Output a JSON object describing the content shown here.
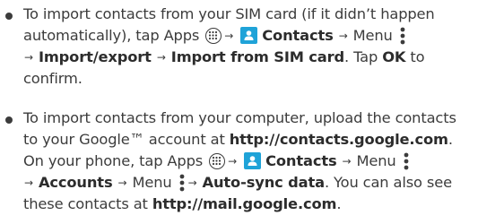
{
  "bullets": [
    {
      "line1": {
        "pre": "To import contacts from your SIM card (if it didn’t happen",
        "pre2": "automatically), tap Apps",
        "contacts": "Contacts",
        "menu": "Menu"
      },
      "line3": {
        "import_export": "Import/export",
        "import_sim": "Import from SIM card",
        "tap": ". Tap ",
        "ok": "OK",
        "to": " to"
      },
      "line4": "confirm."
    },
    {
      "line1": "To import contacts from your computer, upload the contacts",
      "line2": {
        "pre": "to your Google™ account at ",
        "url": "http://contacts.google.com",
        "post": "."
      },
      "line3": {
        "pre": "On your phone, tap Apps",
        "contacts": "Contacts",
        "menu": "Menu"
      },
      "line4": {
        "accounts": "Accounts",
        "menu": "Menu",
        "autosync": "Auto-sync data",
        "post": ". You can also see"
      },
      "line5": {
        "pre": "these contacts at ",
        "url": "http://mail.google.com",
        "post": "."
      }
    }
  ],
  "glyphs": {
    "arrow": "→"
  },
  "icons": {
    "apps": "apps-grid-icon",
    "contacts": "contacts-app-icon",
    "menu": "overflow-menu-icon",
    "contacts_color": "#1fa3d8"
  }
}
